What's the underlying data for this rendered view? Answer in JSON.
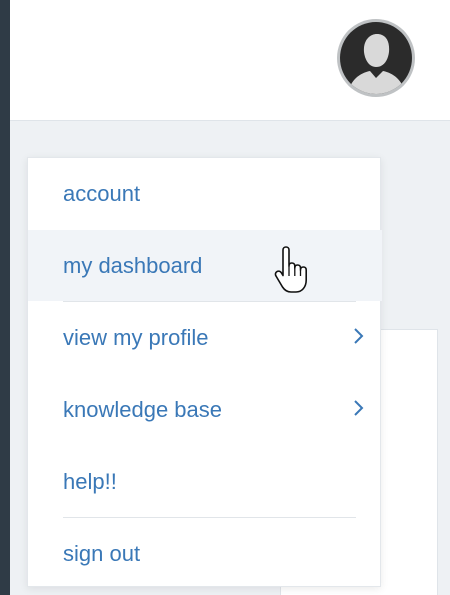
{
  "header": {
    "avatar_icon": "user-avatar-icon"
  },
  "dropdown_menu": {
    "items": [
      {
        "label": "account",
        "has_submenu": false,
        "hovered": false
      },
      {
        "label": "my dashboard",
        "has_submenu": false,
        "hovered": true
      },
      {
        "label": "view my profile",
        "has_submenu": true,
        "hovered": false
      },
      {
        "label": "knowledge base",
        "has_submenu": true,
        "hovered": false
      },
      {
        "label": "help!!",
        "has_submenu": false,
        "hovered": false
      },
      {
        "label": "sign out",
        "has_submenu": false,
        "hovered": false
      }
    ]
  },
  "colors": {
    "outer_frame": "#2f3b46",
    "app_background": "#eef1f4",
    "menu_text": "#3a78b7",
    "hover_background": "#f1f4f8"
  },
  "cursor_icon": "hand-pointer-icon"
}
